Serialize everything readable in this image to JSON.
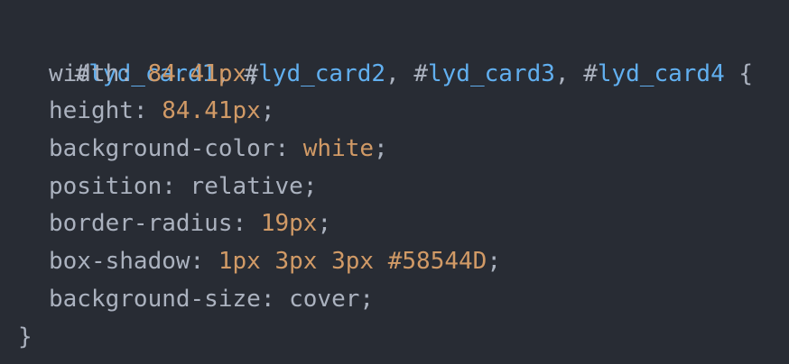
{
  "code": {
    "selectors": [
      {
        "hash": "#",
        "name": "lyd_card1"
      },
      {
        "hash": "#",
        "name": "lyd_card2"
      },
      {
        "hash": "#",
        "name": "lyd_card3"
      },
      {
        "hash": "#",
        "name": "lyd_card4"
      }
    ],
    "separator": ", ",
    "open_brace": " {",
    "close_brace": "}",
    "declarations": [
      {
        "prop": "width",
        "value": "84.41px",
        "value_class": "num"
      },
      {
        "prop": "height",
        "value": "84.41px",
        "value_class": "num"
      },
      {
        "prop": "background-color",
        "value": "white",
        "value_class": "kw"
      },
      {
        "prop": "position",
        "value": "relative",
        "value_class": "plain"
      },
      {
        "prop": "border-radius",
        "value": "19px",
        "value_class": "num"
      },
      {
        "prop": "box-shadow",
        "value_parts": [
          {
            "text": "1px",
            "cls": "num"
          },
          {
            "text": " ",
            "cls": "plain"
          },
          {
            "text": "3px",
            "cls": "num"
          },
          {
            "text": " ",
            "cls": "plain"
          },
          {
            "text": "3px",
            "cls": "num"
          },
          {
            "text": " ",
            "cls": "plain"
          },
          {
            "text": "#58544D",
            "cls": "num"
          }
        ]
      },
      {
        "prop": "background-size",
        "value": "cover",
        "value_class": "plain"
      }
    ],
    "colon": ": ",
    "semicolon": ";"
  },
  "theme": {
    "background": "#282c34",
    "text": "#abb2bf",
    "selector": "#61afef",
    "number": "#d19a66"
  }
}
